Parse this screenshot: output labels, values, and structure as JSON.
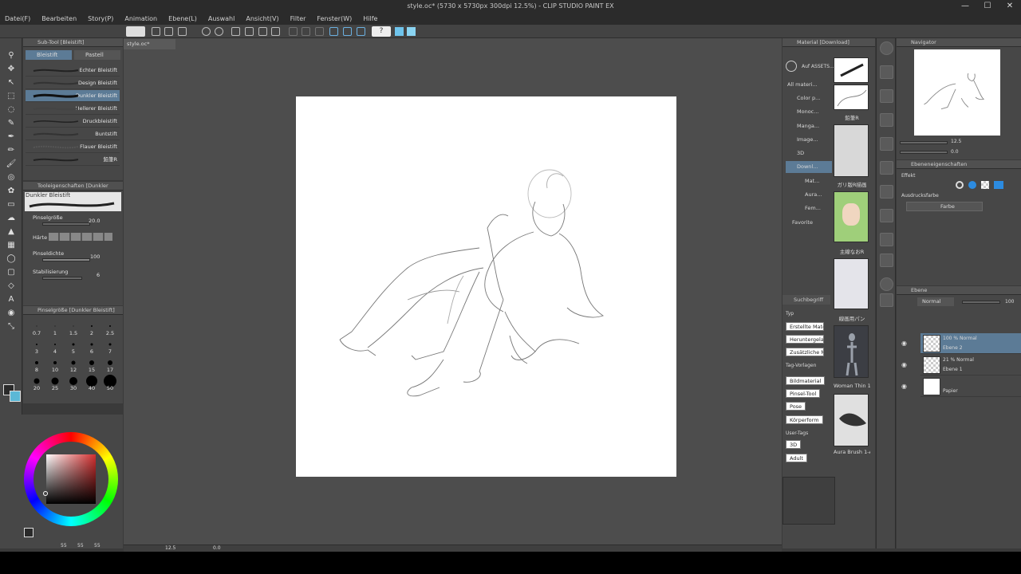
{
  "window": {
    "title": "style.oc* (5730 x 5730px 300dpi 12.5%) - CLIP STUDIO PAINT EX",
    "controls": [
      "—",
      "☐",
      "✕"
    ]
  },
  "menu": [
    "Datei(F)",
    "Bearbeiten",
    "Story(P)",
    "Animation",
    "Ebene(L)",
    "Auswahl",
    "Ansicht(V)",
    "Filter",
    "Fenster(W)",
    "Hilfe"
  ],
  "document": {
    "tab": "style.oc*",
    "zoom": "12.5",
    "rotation": "0.0"
  },
  "subtool": {
    "header": "Sub-Tool [Bleistift]",
    "tabs": [
      "Bleistift",
      "Pastell"
    ],
    "brushes": [
      "Echter Bleistift",
      "Design Bleistift",
      "Dunkler Bleistift",
      "Hellerer Bleistift",
      "Druckbleistift",
      "Buntstift",
      "Flauer Bleistift",
      "鉛筆R"
    ],
    "selected_index": 2
  },
  "toolprops": {
    "header": "Tooleigenschaften [Dunkler Blei...]",
    "brush_name": "Dunkler Bleistift",
    "size_label": "Pinselgröße",
    "size_value": "20.0",
    "hardness_label": "Härte",
    "density_label": "Pinseldichte",
    "density_value": "100",
    "stabil_label": "Stabilisierung",
    "stabil_value": "6"
  },
  "brushsize": {
    "header": "Pinselgröße [Dunkler Bleistift]",
    "sizes": [
      "0.7",
      "1",
      "1.5",
      "2",
      "2.5",
      "3",
      "4",
      "5",
      "6",
      "7",
      "8",
      "10",
      "12",
      "15",
      "17",
      "20",
      "25",
      "30",
      "40",
      "50"
    ]
  },
  "colors": {
    "main": "#2a2a2a",
    "sub": "#5bb8d6",
    "picker_hue": "#d32f2f",
    "values": [
      "55",
      "55",
      "55"
    ]
  },
  "materials": {
    "header": "Material [Download]",
    "search_label": "Auf ASSETS...",
    "tree": [
      "All materi...",
      "Color p...",
      "Monoc...",
      "Manga...",
      "Image...",
      "3D",
      "Downl...",
      "Mat...",
      "Aura...",
      "Fem...",
      "Favorite"
    ],
    "thumbs": [
      "",
      "鉛筆R",
      "ガリ版R描画",
      "主線なおR",
      "線画用パン",
      "Woman Thin 1",
      "Aura Brush 1-A"
    ],
    "search_header": "Suchbegriff",
    "type_label": "Typ",
    "type_buttons": [
      "Erstellte Mate...",
      "Heruntergelad...",
      "Zusätzliche M..."
    ],
    "tag_label": "Tag-Vorlagen",
    "tag_buttons": [
      "Bildmaterial",
      "Pinsel-Tool",
      "Pose",
      "Körperform"
    ],
    "user_tag_label": "User-Tags",
    "user_tags": [
      "3D",
      "Adult"
    ]
  },
  "navigator": {
    "header": "Navigator",
    "zoom": "12.5",
    "rotation": "0.0"
  },
  "layerprop": {
    "header": "Ebeneneigenschaften",
    "effect_label": "Effekt",
    "color_label": "Ausdrucksfarbe",
    "color_value": "Farbe"
  },
  "layers": {
    "header": "Ebene",
    "blend_mode": "Normal",
    "opacity": "100",
    "items": [
      {
        "mode": "100 % Normal",
        "name": "Ebene 2",
        "selected": true
      },
      {
        "mode": "21 % Normal",
        "name": "Ebene 1",
        "selected": false
      },
      {
        "mode": "",
        "name": "Papier",
        "selected": false
      }
    ]
  }
}
